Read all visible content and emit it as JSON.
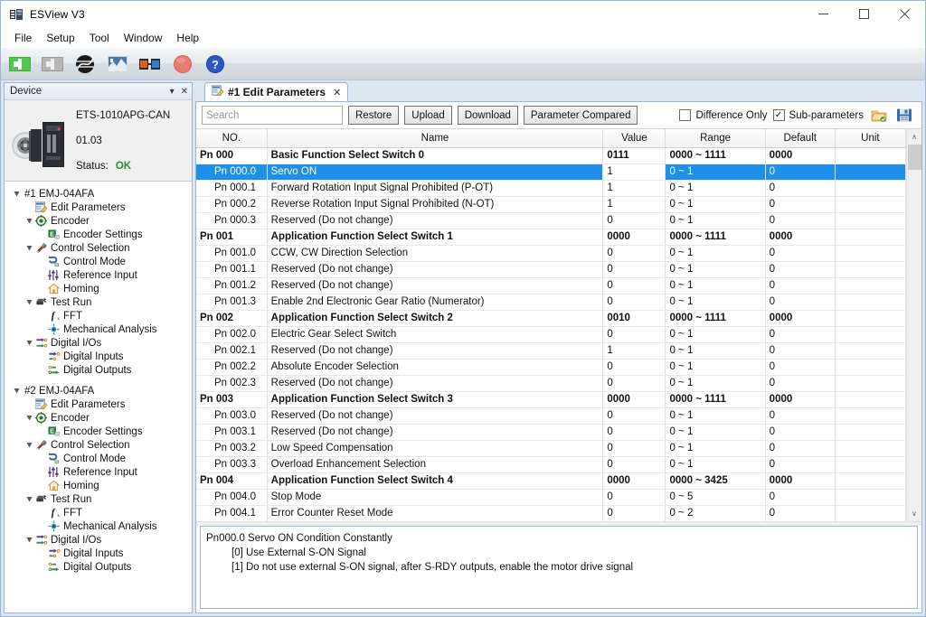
{
  "window": {
    "title": "ESView V3",
    "app_icon": "app-icon",
    "minimize": "—",
    "maximize": "□",
    "close": "✕"
  },
  "menubar": [
    "File",
    "Setup",
    "Tool",
    "Window",
    "Help"
  ],
  "toolbar": {
    "icons": [
      {
        "name": "connect-icon",
        "title": "Connect"
      },
      {
        "name": "disconnect-icon",
        "title": "Disconnect"
      },
      {
        "name": "scope-icon",
        "title": "Scope"
      },
      {
        "name": "wave-icon",
        "title": "Wave"
      },
      {
        "name": "link-icon",
        "title": "Link"
      },
      {
        "name": "stop-icon",
        "title": "Stop"
      },
      {
        "name": "help-icon",
        "title": "Help"
      }
    ]
  },
  "device_panel": {
    "header_title": "Device",
    "header_menu_icon": "▾",
    "header_close_icon": "✕",
    "model": "ETS-1010APG-CAN",
    "version": "01.03",
    "status_label": "Status:",
    "status_value": "OK",
    "status_color": "#2e8b2e",
    "tree": [
      {
        "label": "#1 EMJ-04AFA",
        "depth": 0,
        "arrow": true,
        "icon": "none"
      },
      {
        "label": "Edit Parameters",
        "depth": 1,
        "arrow": false,
        "icon": "edit-parameters-icon"
      },
      {
        "label": "Encoder",
        "depth": 1,
        "arrow": true,
        "icon": "encoder-icon"
      },
      {
        "label": "Encoder Settings",
        "depth": 2,
        "arrow": false,
        "icon": "encoder-settings-icon"
      },
      {
        "label": "Control Selection",
        "depth": 1,
        "arrow": true,
        "icon": "control-selection-icon"
      },
      {
        "label": "Control Mode",
        "depth": 2,
        "arrow": false,
        "icon": "control-mode-icon"
      },
      {
        "label": "Reference Input",
        "depth": 2,
        "arrow": false,
        "icon": "reference-input-icon"
      },
      {
        "label": "Homing",
        "depth": 2,
        "arrow": false,
        "icon": "homing-icon"
      },
      {
        "label": "Test Run",
        "depth": 1,
        "arrow": true,
        "icon": "test-run-icon"
      },
      {
        "label": "FFT",
        "depth": 2,
        "arrow": false,
        "icon": "fft-icon"
      },
      {
        "label": "Mechanical Analysis",
        "depth": 2,
        "arrow": false,
        "icon": "mechanical-analysis-icon"
      },
      {
        "label": "Digital I/Os",
        "depth": 1,
        "arrow": true,
        "icon": "digital-ios-icon"
      },
      {
        "label": "Digital Inputs",
        "depth": 2,
        "arrow": false,
        "icon": "digital-inputs-icon"
      },
      {
        "label": "Digital Outputs",
        "depth": 2,
        "arrow": false,
        "icon": "digital-outputs-icon"
      },
      {
        "label": "",
        "depth": 0,
        "arrow": false,
        "icon": "none"
      },
      {
        "label": "#2 EMJ-04AFA",
        "depth": 0,
        "arrow": true,
        "icon": "none"
      },
      {
        "label": "Edit Parameters",
        "depth": 1,
        "arrow": false,
        "icon": "edit-parameters-icon"
      },
      {
        "label": "Encoder",
        "depth": 1,
        "arrow": true,
        "icon": "encoder-icon"
      },
      {
        "label": "Encoder Settings",
        "depth": 2,
        "arrow": false,
        "icon": "encoder-settings-icon"
      },
      {
        "label": "Control Selection",
        "depth": 1,
        "arrow": true,
        "icon": "control-selection-icon"
      },
      {
        "label": "Control Mode",
        "depth": 2,
        "arrow": false,
        "icon": "control-mode-icon"
      },
      {
        "label": "Reference Input",
        "depth": 2,
        "arrow": false,
        "icon": "reference-input-icon"
      },
      {
        "label": "Homing",
        "depth": 2,
        "arrow": false,
        "icon": "homing-icon"
      },
      {
        "label": "Test Run",
        "depth": 1,
        "arrow": true,
        "icon": "test-run-icon"
      },
      {
        "label": "FFT",
        "depth": 2,
        "arrow": false,
        "icon": "fft-icon"
      },
      {
        "label": "Mechanical Analysis",
        "depth": 2,
        "arrow": false,
        "icon": "mechanical-analysis-icon"
      },
      {
        "label": "Digital I/Os",
        "depth": 1,
        "arrow": true,
        "icon": "digital-ios-icon"
      },
      {
        "label": "Digital Inputs",
        "depth": 2,
        "arrow": false,
        "icon": "digital-inputs-icon"
      },
      {
        "label": "Digital Outputs",
        "depth": 2,
        "arrow": false,
        "icon": "digital-outputs-icon"
      }
    ]
  },
  "tabs": [
    {
      "label": "#1 Edit Parameters",
      "icon": "edit-parameters-icon",
      "close": "✕",
      "active": true
    }
  ],
  "panel_toolbar": {
    "search_placeholder": "Search",
    "search_value": "",
    "buttons": [
      "Restore",
      "Upload",
      "Download",
      "Parameter Compared"
    ],
    "checkboxes": [
      {
        "label": "Difference Only",
        "checked": false
      },
      {
        "label": "Sub-parameters",
        "checked": true
      }
    ],
    "open_icon": "open-folder-icon",
    "save_icon": "save-icon"
  },
  "table": {
    "columns": [
      "NO.",
      "Name",
      "Value",
      "Range",
      "Default",
      "Unit"
    ],
    "rows": [
      {
        "no": "Pn 000",
        "name": "Basic Function Select Switch 0",
        "value": "0111",
        "range": "0000 ~ 1111",
        "default": "0000",
        "unit": "",
        "group": true,
        "selected": false
      },
      {
        "no": "Pn 000.0",
        "name": "Servo ON",
        "value": "1",
        "range": "0 ~ 1",
        "default": "0",
        "unit": "",
        "group": false,
        "selected": true
      },
      {
        "no": "Pn 000.1",
        "name": "Forward Rotation Input Signal Prohibited (P-OT)",
        "value": "1",
        "range": "0 ~ 1",
        "default": "0",
        "unit": "",
        "group": false,
        "selected": false
      },
      {
        "no": "Pn 000.2",
        "name": "Reverse Rotation Input Signal Prohibited (N-OT)",
        "value": "1",
        "range": "0 ~ 1",
        "default": "0",
        "unit": "",
        "group": false,
        "selected": false
      },
      {
        "no": "Pn 000.3",
        "name": "Reserved (Do not change)",
        "value": "0",
        "range": "0 ~ 1",
        "default": "0",
        "unit": "",
        "group": false,
        "selected": false
      },
      {
        "no": "Pn 001",
        "name": "Application Function Select Switch 1",
        "value": "0000",
        "range": "0000 ~ 1111",
        "default": "0000",
        "unit": "",
        "group": true,
        "selected": false
      },
      {
        "no": "Pn 001.0",
        "name": "CCW, CW Direction Selection",
        "value": "0",
        "range": "0 ~ 1",
        "default": "0",
        "unit": "",
        "group": false,
        "selected": false
      },
      {
        "no": "Pn 001.1",
        "name": "Reserved (Do not change)",
        "value": "0",
        "range": "0 ~ 1",
        "default": "0",
        "unit": "",
        "group": false,
        "selected": false
      },
      {
        "no": "Pn 001.2",
        "name": "Reserved (Do not change)",
        "value": "0",
        "range": "0 ~ 1",
        "default": "0",
        "unit": "",
        "group": false,
        "selected": false
      },
      {
        "no": "Pn 001.3",
        "name": "Enable 2nd Electronic Gear Ratio (Numerator)",
        "value": "0",
        "range": "0 ~ 1",
        "default": "0",
        "unit": "",
        "group": false,
        "selected": false
      },
      {
        "no": "Pn 002",
        "name": "Application Function Select Switch 2",
        "value": "0010",
        "range": "0000 ~ 1111",
        "default": "0000",
        "unit": "",
        "group": true,
        "selected": false
      },
      {
        "no": "Pn 002.0",
        "name": "Electric Gear Select Switch",
        "value": "0",
        "range": "0 ~ 1",
        "default": "0",
        "unit": "",
        "group": false,
        "selected": false
      },
      {
        "no": "Pn 002.1",
        "name": "Reserved (Do not change)",
        "value": "1",
        "range": "0 ~ 1",
        "default": "0",
        "unit": "",
        "group": false,
        "selected": false
      },
      {
        "no": "Pn 002.2",
        "name": "Absolute Encoder Selection",
        "value": "0",
        "range": "0 ~ 1",
        "default": "0",
        "unit": "",
        "group": false,
        "selected": false
      },
      {
        "no": "Pn 002.3",
        "name": "Reserved (Do not change)",
        "value": "0",
        "range": "0 ~ 1",
        "default": "0",
        "unit": "",
        "group": false,
        "selected": false
      },
      {
        "no": "Pn 003",
        "name": "Application Function Select Switch 3",
        "value": "0000",
        "range": "0000 ~ 1111",
        "default": "0000",
        "unit": "",
        "group": true,
        "selected": false
      },
      {
        "no": "Pn 003.0",
        "name": "Reserved (Do not change)",
        "value": "0",
        "range": "0 ~ 1",
        "default": "0",
        "unit": "",
        "group": false,
        "selected": false
      },
      {
        "no": "Pn 003.1",
        "name": "Reserved (Do not change)",
        "value": "0",
        "range": "0 ~ 1",
        "default": "0",
        "unit": "",
        "group": false,
        "selected": false
      },
      {
        "no": "Pn 003.2",
        "name": "Low Speed Compensation",
        "value": "0",
        "range": "0 ~ 1",
        "default": "0",
        "unit": "",
        "group": false,
        "selected": false
      },
      {
        "no": "Pn 003.3",
        "name": "Overload Enhancement Selection",
        "value": "0",
        "range": "0 ~ 1",
        "default": "0",
        "unit": "",
        "group": false,
        "selected": false
      },
      {
        "no": "Pn 004",
        "name": "Application Function Select Switch 4",
        "value": "0000",
        "range": "0000 ~ 3425",
        "default": "0000",
        "unit": "",
        "group": true,
        "selected": false
      },
      {
        "no": "Pn 004.0",
        "name": "Stop Mode",
        "value": "0",
        "range": "0 ~ 5",
        "default": "0",
        "unit": "",
        "group": false,
        "selected": false
      },
      {
        "no": "Pn 004.1",
        "name": "Error Counter Reset Mode",
        "value": "0",
        "range": "0 ~ 2",
        "default": "0",
        "unit": "",
        "group": false,
        "selected": false
      }
    ]
  },
  "description": {
    "lines": [
      {
        "text": "Pn000.0  Servo ON Condition Constantly",
        "indent": false
      },
      {
        "text": "[0] Use External S-ON Signal",
        "indent": true
      },
      {
        "text": "[1] Do not use external S-ON signal, after S-RDY outputs, enable the motor drive signal",
        "indent": true
      }
    ]
  },
  "scrollbar": {
    "up": "∧",
    "down": "∨"
  }
}
